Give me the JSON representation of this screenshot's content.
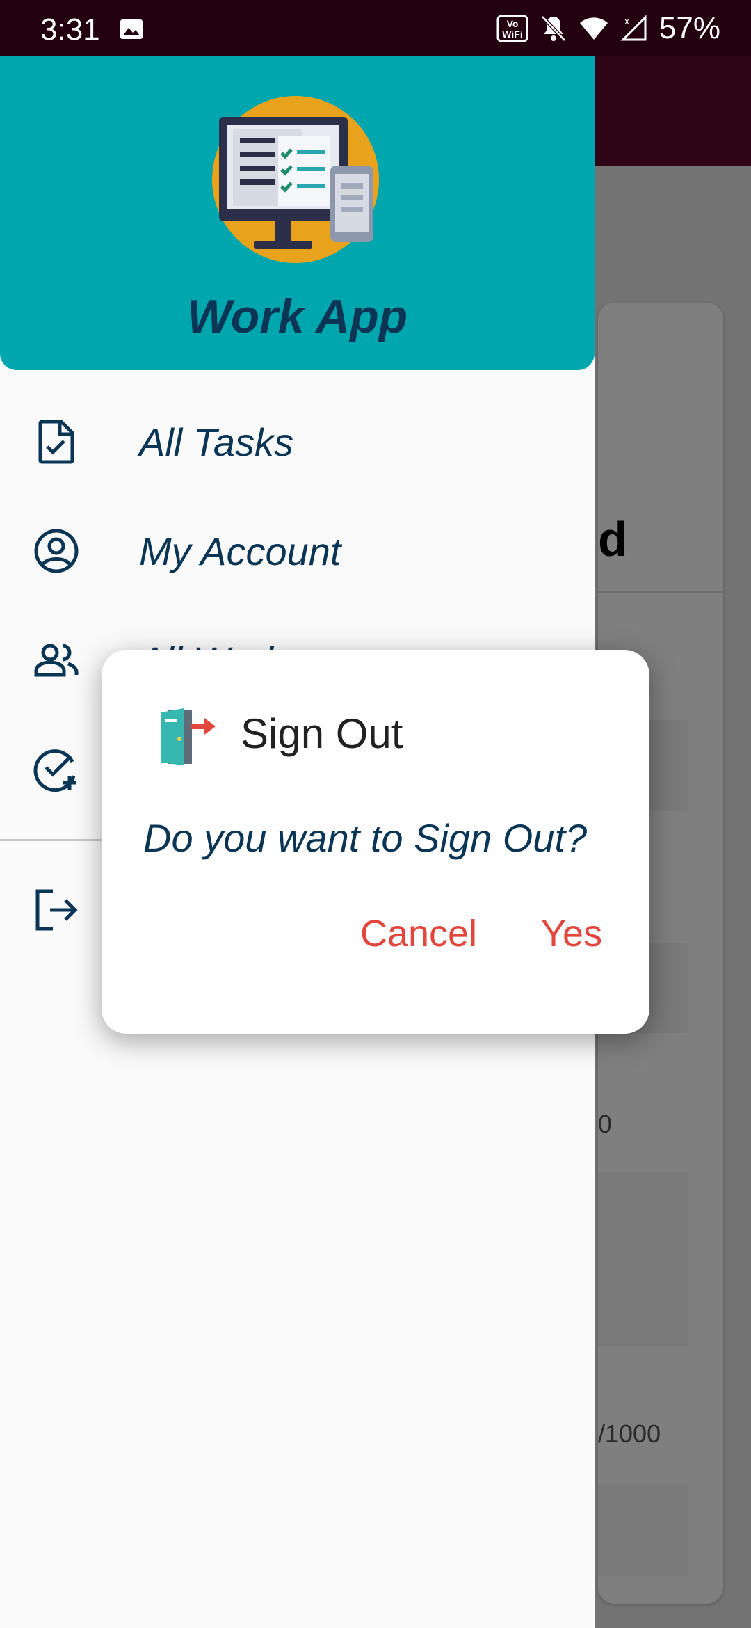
{
  "status_bar": {
    "time": "3:31",
    "battery": "57%",
    "icons": [
      "gallery-icon",
      "vowifi-icon",
      "bell-off-icon",
      "wifi-icon",
      "signal-icon"
    ]
  },
  "background": {
    "card_title_fragment": "d",
    "text_fragment_a": "0",
    "text_fragment_b": "/1000"
  },
  "drawer": {
    "app_name": "Work App",
    "items": [
      {
        "label": "All Tasks",
        "icon": "task-check-icon"
      },
      {
        "label": "My Account",
        "icon": "account-circle-icon"
      },
      {
        "label": "All Work",
        "icon": "people-icon"
      },
      {
        "label": "",
        "icon": "add-task-icon"
      },
      {
        "label": "",
        "icon": "logout-icon"
      }
    ]
  },
  "dialog": {
    "title": "Sign Out",
    "message": "Do you want to Sign Out?",
    "cancel_label": "Cancel",
    "confirm_label": "Yes",
    "icon": "door-exit-icon"
  },
  "colors": {
    "status_bar": "#23000f",
    "drawer_header": "#00a6ae",
    "text_primary": "#0b3555",
    "accent_button": "#e2463d",
    "app_bar": "#5a0b2c"
  }
}
